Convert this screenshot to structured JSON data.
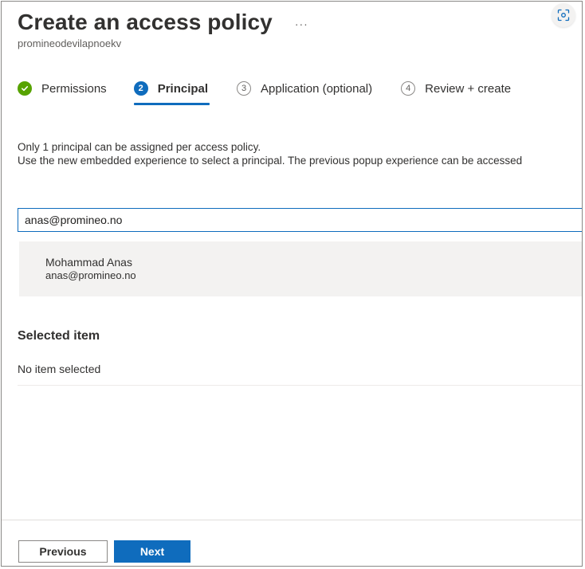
{
  "header": {
    "title": "Create an access policy",
    "more_label": "···",
    "subtitle": "promineodevilapnoekv"
  },
  "steps": [
    {
      "label": "Permissions",
      "number": "",
      "state": "done"
    },
    {
      "label": "Principal",
      "number": "2",
      "state": "active"
    },
    {
      "label": "Application (optional)",
      "number": "3",
      "state": "pending"
    },
    {
      "label": "Review + create",
      "number": "4",
      "state": "pending"
    }
  ],
  "info": {
    "line1": "Only 1 principal can be assigned per access policy.",
    "line2": "Use the new embedded experience to select a principal. The previous popup experience can be accessed"
  },
  "search": {
    "value": "anas@promineo.no",
    "placeholder": ""
  },
  "results": [
    {
      "name": "Mohammad Anas",
      "email": "anas@promineo.no"
    }
  ],
  "selected": {
    "heading": "Selected item",
    "empty_text": "No item selected"
  },
  "footer": {
    "previous_label": "Previous",
    "next_label": "Next"
  },
  "colors": {
    "accent": "#0f6cbd",
    "success": "#57a300",
    "result_bg": "#f3f2f1"
  },
  "icons": {
    "focus": "focus-mode-icon",
    "done": "checkmark-icon"
  }
}
